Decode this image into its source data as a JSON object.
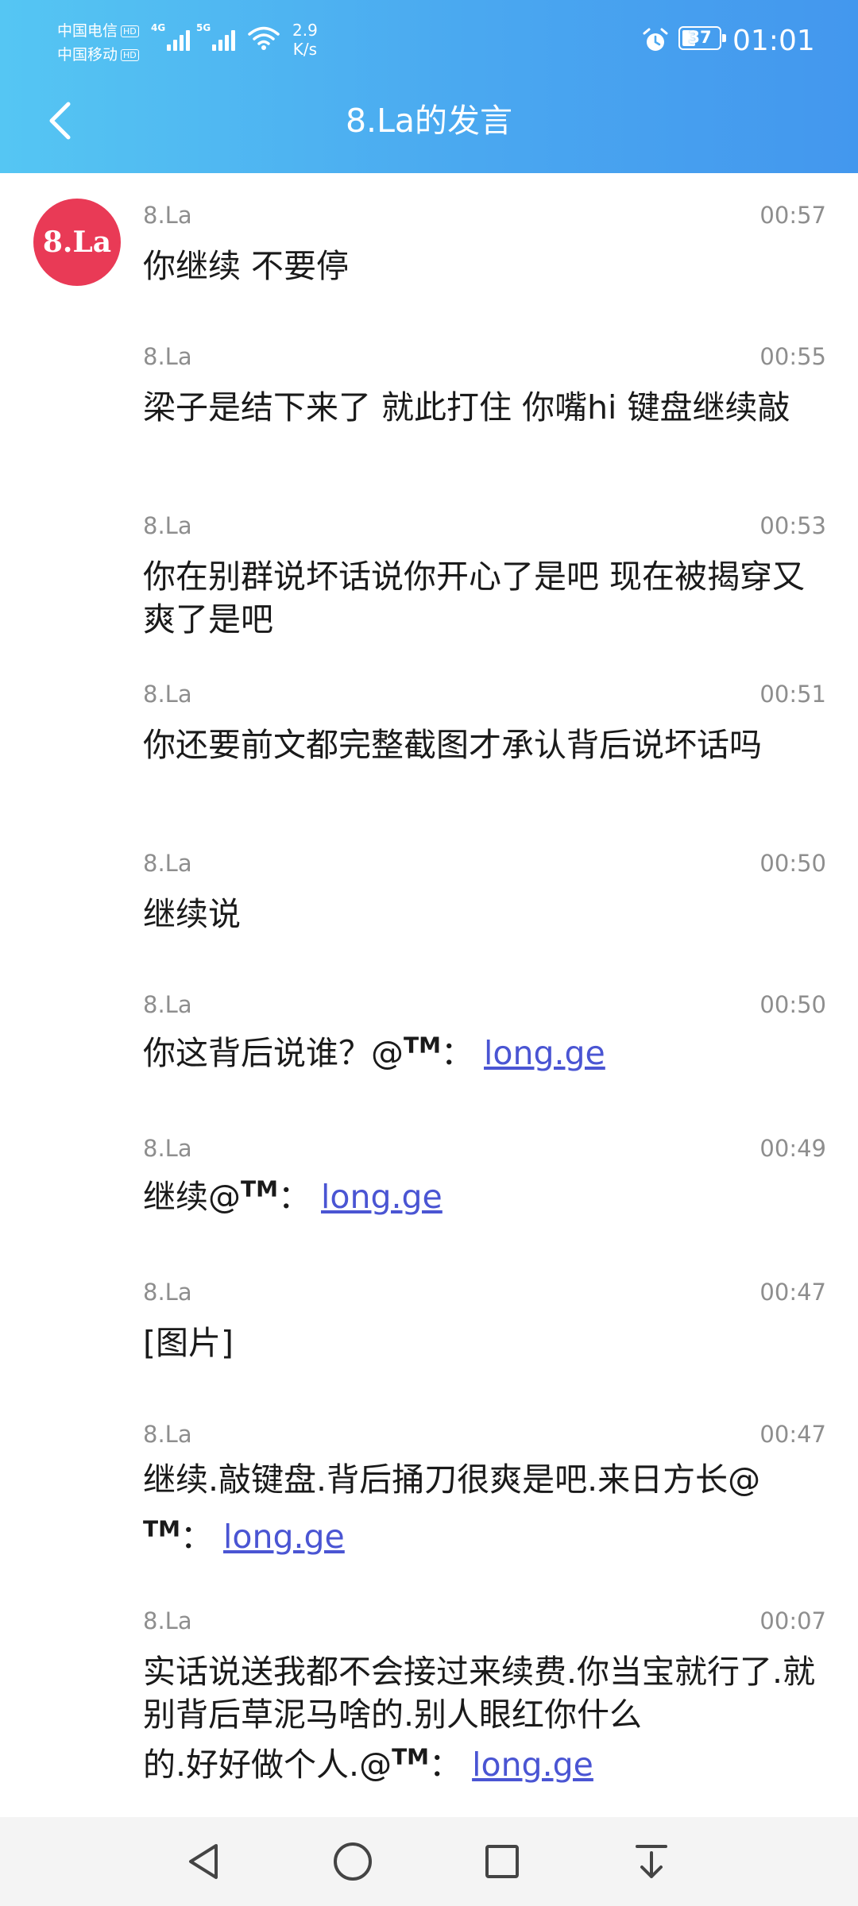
{
  "status_bar": {
    "carrier_1": "中国电信",
    "carrier_2": "中国移动",
    "hd_label": "HD",
    "network_1": "4G",
    "network_2": "5G",
    "speed_value": "2.9",
    "speed_unit": "K/s",
    "battery": "37",
    "time": "01:01"
  },
  "header": {
    "title": "8.La的发言"
  },
  "user": {
    "avatar_text": "8.La"
  },
  "messages": [
    {
      "author": "8.La",
      "time": "00:57",
      "text": "你继续 不要停"
    },
    {
      "author": "8.La",
      "time": "00:55",
      "text": "梁子是结下来了 就此打住 你嘴hi 键盘继续敲"
    },
    {
      "author": "8.La",
      "time": "00:53",
      "text": "你在别群说坏话说你开心了是吧 现在被揭穿又爽了是吧"
    },
    {
      "author": "8.La",
      "time": "00:51",
      "text": "你还要前文都完整截图才承认背后说坏话吗"
    },
    {
      "author": "8.La",
      "time": "00:50",
      "text": "继续说"
    },
    {
      "author": "8.La",
      "time": "00:50",
      "text": "你这背后说谁？@",
      "tm": "TM",
      "sep": "：",
      "link": "long.ge"
    },
    {
      "author": "8.La",
      "time": "00:49",
      "text": "继续@",
      "tm": "TM",
      "sep": "：",
      "link": "long.ge"
    },
    {
      "author": "8.La",
      "time": "00:47",
      "text": "[图片]"
    },
    {
      "author": "8.La",
      "time": "00:47",
      "text": "继续.敲键盘.背后捅刀很爽是吧.来日方长@",
      "tm": "TM",
      "sep": "：",
      "link": "long.ge"
    },
    {
      "author": "8.La",
      "time": "00:07",
      "text_1": "实话说送我都不会接过来续费.你当宝就行了.就别背后草泥马啥的.别人眼红你什么",
      "text_2": "的.好好做个人.@",
      "tm": "TM",
      "sep": "：",
      "link": "long.ge"
    }
  ],
  "colors": {
    "header_start": "#55c6f3",
    "header_end": "#4397ee",
    "avatar_bg": "#e93a56",
    "link": "#4a55d3",
    "meta_text": "#8e8e8e"
  },
  "navigation": {
    "icons": [
      "back-triangle-icon",
      "home-circle-icon",
      "recents-square-icon",
      "notification-pull-down-icon"
    ]
  }
}
